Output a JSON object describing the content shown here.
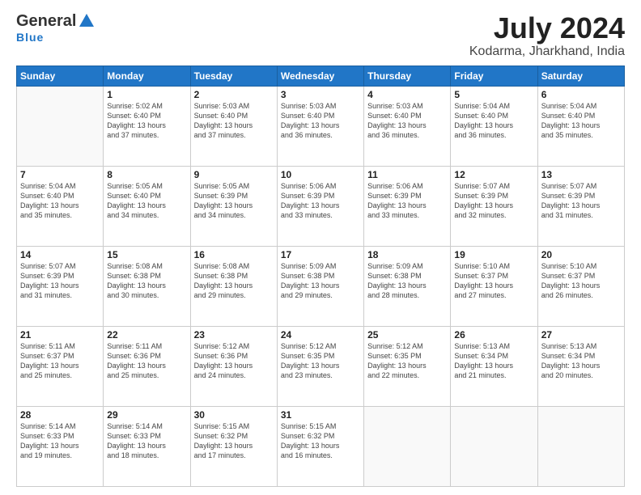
{
  "logo": {
    "general": "General",
    "blue": "Blue",
    "sub": "Blue"
  },
  "title": "July 2024",
  "subtitle": "Kodarma, Jharkhand, India",
  "weekdays": [
    "Sunday",
    "Monday",
    "Tuesday",
    "Wednesday",
    "Thursday",
    "Friday",
    "Saturday"
  ],
  "weeks": [
    [
      {
        "day": "",
        "info": ""
      },
      {
        "day": "1",
        "info": "Sunrise: 5:02 AM\nSunset: 6:40 PM\nDaylight: 13 hours\nand 37 minutes."
      },
      {
        "day": "2",
        "info": "Sunrise: 5:03 AM\nSunset: 6:40 PM\nDaylight: 13 hours\nand 37 minutes."
      },
      {
        "day": "3",
        "info": "Sunrise: 5:03 AM\nSunset: 6:40 PM\nDaylight: 13 hours\nand 36 minutes."
      },
      {
        "day": "4",
        "info": "Sunrise: 5:03 AM\nSunset: 6:40 PM\nDaylight: 13 hours\nand 36 minutes."
      },
      {
        "day": "5",
        "info": "Sunrise: 5:04 AM\nSunset: 6:40 PM\nDaylight: 13 hours\nand 36 minutes."
      },
      {
        "day": "6",
        "info": "Sunrise: 5:04 AM\nSunset: 6:40 PM\nDaylight: 13 hours\nand 35 minutes."
      }
    ],
    [
      {
        "day": "7",
        "info": "Sunrise: 5:04 AM\nSunset: 6:40 PM\nDaylight: 13 hours\nand 35 minutes."
      },
      {
        "day": "8",
        "info": "Sunrise: 5:05 AM\nSunset: 6:40 PM\nDaylight: 13 hours\nand 34 minutes."
      },
      {
        "day": "9",
        "info": "Sunrise: 5:05 AM\nSunset: 6:39 PM\nDaylight: 13 hours\nand 34 minutes."
      },
      {
        "day": "10",
        "info": "Sunrise: 5:06 AM\nSunset: 6:39 PM\nDaylight: 13 hours\nand 33 minutes."
      },
      {
        "day": "11",
        "info": "Sunrise: 5:06 AM\nSunset: 6:39 PM\nDaylight: 13 hours\nand 33 minutes."
      },
      {
        "day": "12",
        "info": "Sunrise: 5:07 AM\nSunset: 6:39 PM\nDaylight: 13 hours\nand 32 minutes."
      },
      {
        "day": "13",
        "info": "Sunrise: 5:07 AM\nSunset: 6:39 PM\nDaylight: 13 hours\nand 31 minutes."
      }
    ],
    [
      {
        "day": "14",
        "info": "Sunrise: 5:07 AM\nSunset: 6:39 PM\nDaylight: 13 hours\nand 31 minutes."
      },
      {
        "day": "15",
        "info": "Sunrise: 5:08 AM\nSunset: 6:38 PM\nDaylight: 13 hours\nand 30 minutes."
      },
      {
        "day": "16",
        "info": "Sunrise: 5:08 AM\nSunset: 6:38 PM\nDaylight: 13 hours\nand 29 minutes."
      },
      {
        "day": "17",
        "info": "Sunrise: 5:09 AM\nSunset: 6:38 PM\nDaylight: 13 hours\nand 29 minutes."
      },
      {
        "day": "18",
        "info": "Sunrise: 5:09 AM\nSunset: 6:38 PM\nDaylight: 13 hours\nand 28 minutes."
      },
      {
        "day": "19",
        "info": "Sunrise: 5:10 AM\nSunset: 6:37 PM\nDaylight: 13 hours\nand 27 minutes."
      },
      {
        "day": "20",
        "info": "Sunrise: 5:10 AM\nSunset: 6:37 PM\nDaylight: 13 hours\nand 26 minutes."
      }
    ],
    [
      {
        "day": "21",
        "info": "Sunrise: 5:11 AM\nSunset: 6:37 PM\nDaylight: 13 hours\nand 25 minutes."
      },
      {
        "day": "22",
        "info": "Sunrise: 5:11 AM\nSunset: 6:36 PM\nDaylight: 13 hours\nand 25 minutes."
      },
      {
        "day": "23",
        "info": "Sunrise: 5:12 AM\nSunset: 6:36 PM\nDaylight: 13 hours\nand 24 minutes."
      },
      {
        "day": "24",
        "info": "Sunrise: 5:12 AM\nSunset: 6:35 PM\nDaylight: 13 hours\nand 23 minutes."
      },
      {
        "day": "25",
        "info": "Sunrise: 5:12 AM\nSunset: 6:35 PM\nDaylight: 13 hours\nand 22 minutes."
      },
      {
        "day": "26",
        "info": "Sunrise: 5:13 AM\nSunset: 6:34 PM\nDaylight: 13 hours\nand 21 minutes."
      },
      {
        "day": "27",
        "info": "Sunrise: 5:13 AM\nSunset: 6:34 PM\nDaylight: 13 hours\nand 20 minutes."
      }
    ],
    [
      {
        "day": "28",
        "info": "Sunrise: 5:14 AM\nSunset: 6:33 PM\nDaylight: 13 hours\nand 19 minutes."
      },
      {
        "day": "29",
        "info": "Sunrise: 5:14 AM\nSunset: 6:33 PM\nDaylight: 13 hours\nand 18 minutes."
      },
      {
        "day": "30",
        "info": "Sunrise: 5:15 AM\nSunset: 6:32 PM\nDaylight: 13 hours\nand 17 minutes."
      },
      {
        "day": "31",
        "info": "Sunrise: 5:15 AM\nSunset: 6:32 PM\nDaylight: 13 hours\nand 16 minutes."
      },
      {
        "day": "",
        "info": ""
      },
      {
        "day": "",
        "info": ""
      },
      {
        "day": "",
        "info": ""
      }
    ]
  ]
}
